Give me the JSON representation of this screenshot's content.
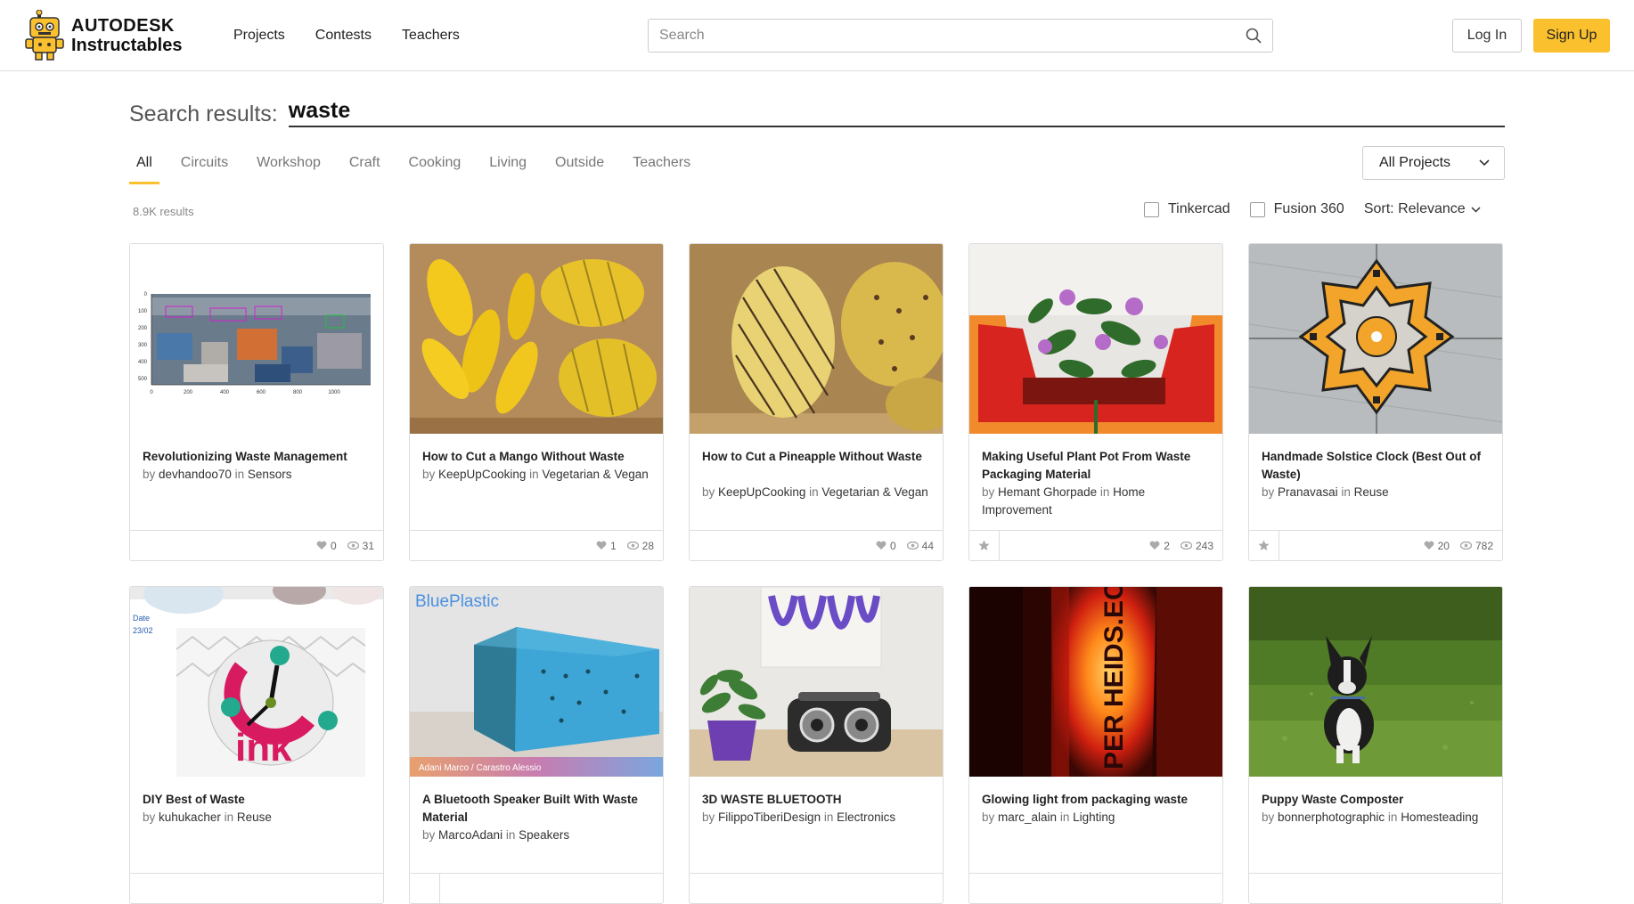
{
  "brand": {
    "top": "AUTODESK",
    "bottom": "Instructables"
  },
  "nav": [
    "Projects",
    "Contests",
    "Teachers"
  ],
  "search": {
    "placeholder": "Search"
  },
  "auth": {
    "login": "Log In",
    "signup": "Sign Up"
  },
  "results": {
    "label": "Search results:",
    "query": "waste",
    "count": "8.9K results"
  },
  "tabs": [
    "All",
    "Circuits",
    "Workshop",
    "Craft",
    "Cooking",
    "Living",
    "Outside",
    "Teachers"
  ],
  "active_tab": "All",
  "project_filter": "All Projects",
  "filters": {
    "tinkercad": "Tinkercad",
    "fusion": "Fusion 360",
    "sort": "Sort: Relevance"
  },
  "cards": [
    {
      "title": "Revolutionizing Waste Management",
      "by": "by",
      "author": "devhandoo70",
      "in": "in",
      "category": "Sensors",
      "likes": "0",
      "views": "31",
      "star": false
    },
    {
      "title": "How to Cut a Mango Without Waste",
      "by": "by",
      "author": "KeepUpCooking",
      "in": "in",
      "category": "Vegetarian & Vegan",
      "likes": "1",
      "views": "28",
      "star": false
    },
    {
      "title": "How to Cut a Pineapple Without Waste",
      "by": "by",
      "author": "KeepUpCooking",
      "in": "in",
      "category": "Vegetarian & Vegan",
      "likes": "0",
      "views": "44",
      "star": false
    },
    {
      "title": "Making Useful Plant Pot From Waste Packaging Material",
      "by": "by",
      "author": "Hemant Ghorpade",
      "in": "in",
      "category": "Home Improvement",
      "likes": "2",
      "views": "243",
      "star": true
    },
    {
      "title": "Handmade Solstice Clock (Best Out of Waste)",
      "by": "by",
      "author": "Pranavasai",
      "in": "in",
      "category": "Reuse",
      "likes": "20",
      "views": "782",
      "star": true
    },
    {
      "title": "DIY Best of Waste",
      "by": "by",
      "author": "kuhukacher",
      "in": "in",
      "category": "Reuse"
    },
    {
      "title": "A Bluetooth Speaker Built With Waste Material",
      "by": "by",
      "author": "MarcoAdani",
      "in": "in",
      "category": "Speakers"
    },
    {
      "title": "3D WASTE BLUETOOTH",
      "by": "by",
      "author": "FilippoTiberiDesign",
      "in": "in",
      "category": "Electronics"
    },
    {
      "title": "Glowing light from packaging waste",
      "by": "by",
      "author": "marc_alain",
      "in": "in",
      "category": "Lighting"
    },
    {
      "title": "Puppy Waste Composter",
      "by": "by",
      "author": "bonnerphotographic",
      "in": "in",
      "category": "Homesteading"
    }
  ],
  "thumb_text": {
    "c1_ticks_y": [
      "0",
      "100",
      "200",
      "300",
      "400",
      "500"
    ],
    "c1_ticks_x": [
      "0",
      "200",
      "400",
      "600",
      "800",
      "1000"
    ],
    "c6_date": "Date",
    "c6_date_val": "23/02",
    "c6_ink": "ink",
    "c7_brand": "BluePlastic",
    "c7_credit": "Adani Marco / Carastro Alessio",
    "c9_text": "PER HEIDS.EC"
  },
  "colors": {
    "accent": "#fbc02d",
    "border": "#dddddd"
  }
}
